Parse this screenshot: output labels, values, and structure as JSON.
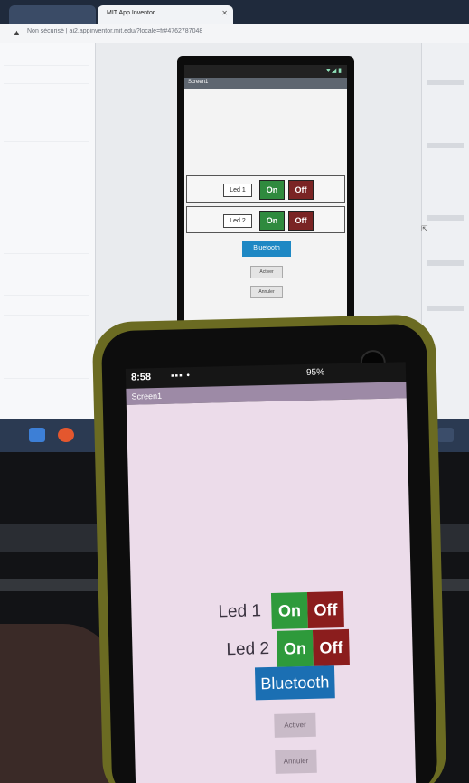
{
  "browser": {
    "tabs": [
      {
        "label": "",
        "active": false
      },
      {
        "label": "MIT App Inventor",
        "active": true
      }
    ],
    "url": "Non sécurisé | ai2.appinventor.mit.edu/?locale=fr#4762787048"
  },
  "emulator": {
    "title": "Screen1",
    "rows": [
      {
        "label": "Led 1",
        "on": "On",
        "off": "Off"
      },
      {
        "label": "Led 2",
        "on": "On",
        "off": "Off"
      }
    ],
    "bluetooth": "Bluetooth",
    "buttons": [
      "Activer",
      "Annuler"
    ]
  },
  "phone": {
    "time": "8:58",
    "battery": "95%",
    "title": "Screen1",
    "rows": [
      {
        "label": "Led 1",
        "on": "On",
        "off": "Off"
      },
      {
        "label": "Led 2",
        "on": "On",
        "off": "Off"
      }
    ],
    "bluetooth": "Bluetooth",
    "buttons": [
      "Activer",
      "Annuler"
    ]
  },
  "colors": {
    "on": "#2e9a3b",
    "off": "#8b1d1d",
    "bluetooth": "#1b6fb3",
    "phone_frame": "#6b6b22",
    "screen_bg": "#ecdcea"
  }
}
